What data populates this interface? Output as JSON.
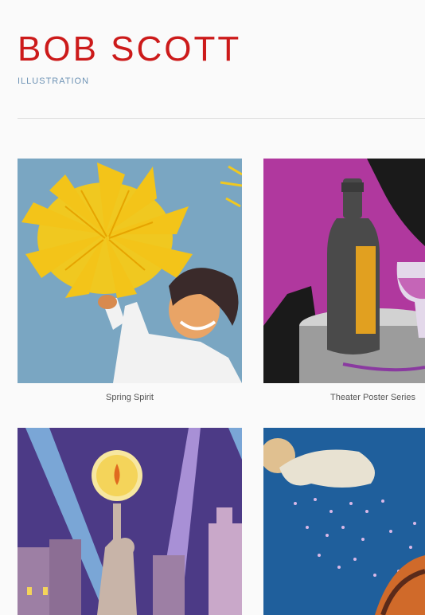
{
  "header": {
    "title": "BOB SCOTT",
    "subtitle": "ILLUSTRATION"
  },
  "gallery": {
    "items": [
      {
        "caption": "Spring Spirit"
      },
      {
        "caption": "Theater Poster Series"
      },
      {
        "caption": ""
      },
      {
        "caption": ""
      }
    ]
  },
  "colors": {
    "title": "#cc1a1a",
    "subtitle": "#6e93b5",
    "background": "#fafafa"
  }
}
